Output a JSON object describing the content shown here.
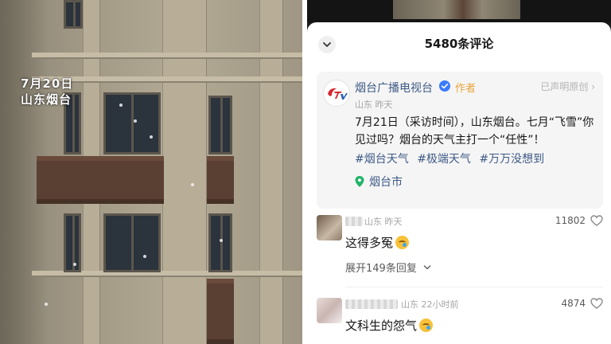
{
  "video": {
    "stamp_date": "7月20日",
    "stamp_location": "山东烟台"
  },
  "comments_sheet": {
    "title": "5480条评论",
    "author_post": {
      "name": "烟台广播电视台",
      "author_tag": "作者",
      "original_label": "已声明原创",
      "meta": "山东 昨天",
      "text": "7月21日（采访时间），山东烟台。七月“飞雪”你见过吗？烟台的天气主打一个“任性”！",
      "hashtags": [
        "#烟台天气",
        "#极端天气",
        "#万万没想到"
      ],
      "location": "烟台市"
    },
    "comments": [
      {
        "meta": "山东 昨天",
        "likes": "11802",
        "text": "这得多冤",
        "expand_label": "展开149条回复"
      },
      {
        "meta": "山东 22小时前",
        "likes": "4874",
        "text": "文科生的怨气"
      }
    ]
  }
}
